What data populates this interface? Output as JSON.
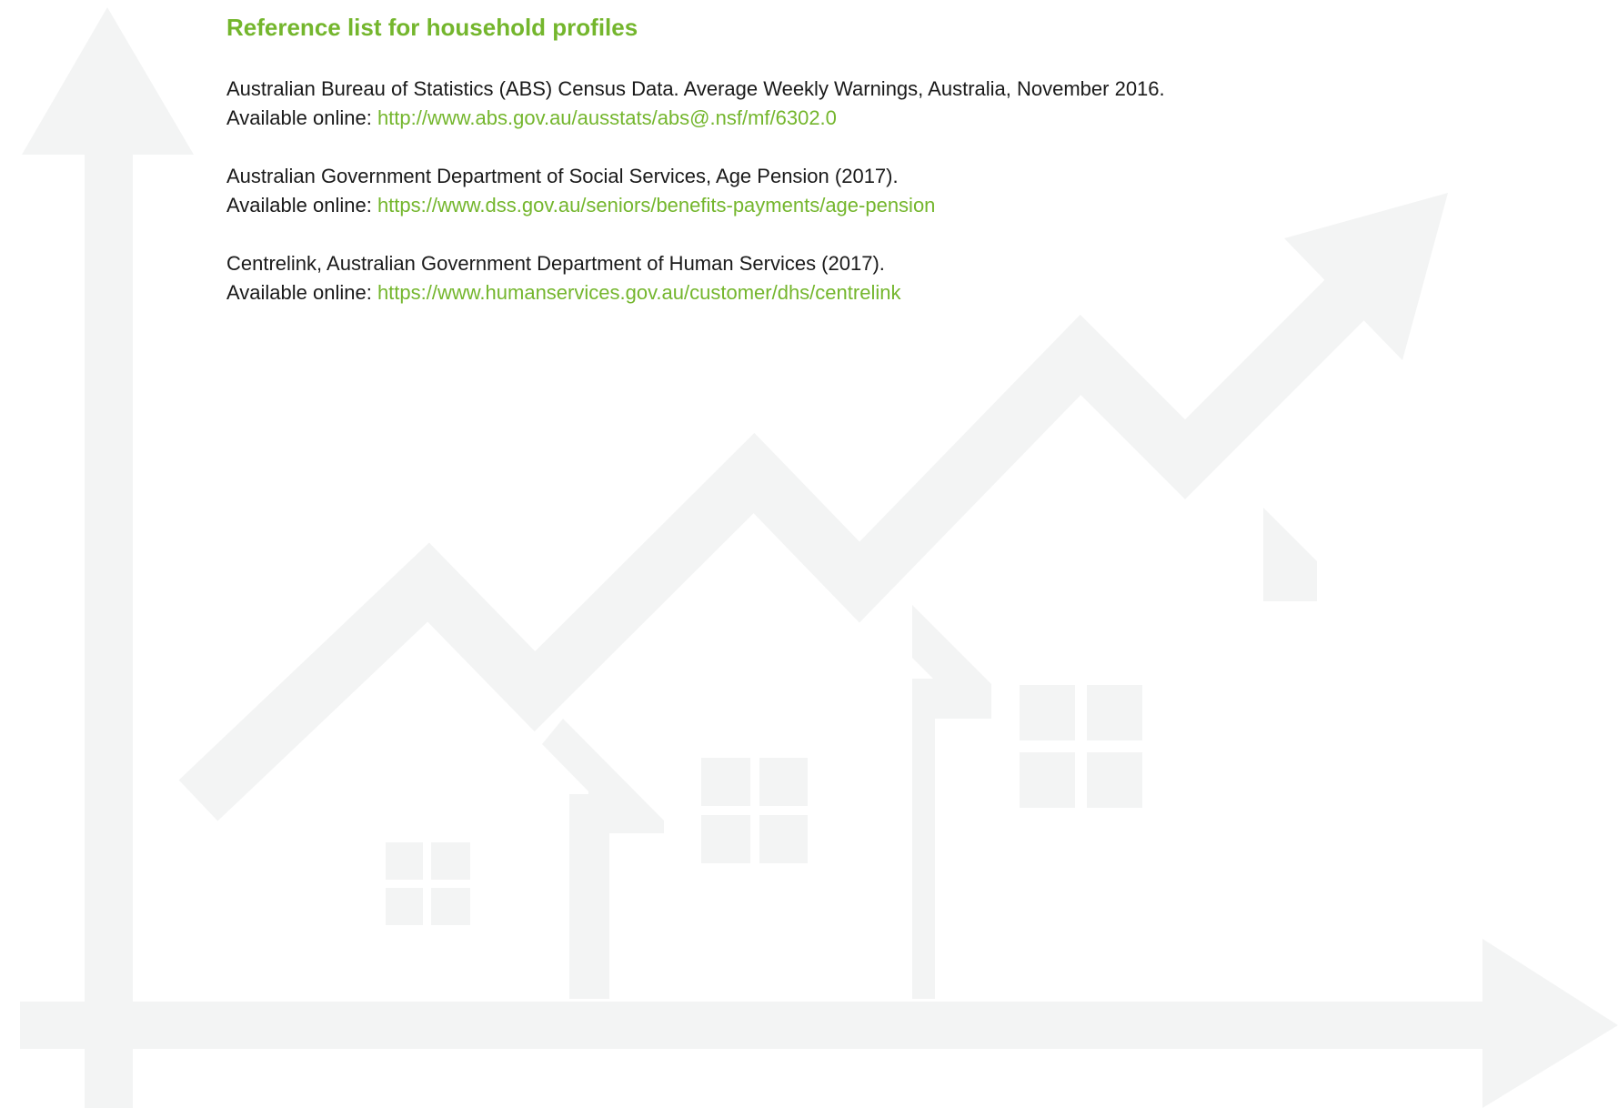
{
  "heading": "Reference list for household profiles",
  "references": [
    {
      "citation": "Australian Bureau of Statistics (ABS) Census Data. Average Weekly Warnings, Australia, November 2016.",
      "available_label": "Available online: ",
      "url": "http://www.abs.gov.au/ausstats/abs@.nsf/mf/6302.0"
    },
    {
      "citation": "Australian Government Department of Social Services, Age Pension (2017).",
      "available_label": "Available online: ",
      "url": "https://www.dss.gov.au/seniors/benefits-payments/age-pension"
    },
    {
      "citation": "Centrelink, Australian Government Department of Human Services (2017).",
      "available_label": "Available online: ",
      "url": "https://www.humanservices.gov.au/customer/dhs/centrelink"
    }
  ],
  "colors": {
    "accent": "#74b62d",
    "text": "#1a1a1a",
    "graphic": "#f3f4f4"
  },
  "background_graphic": "houses-growth-chart-watermark"
}
